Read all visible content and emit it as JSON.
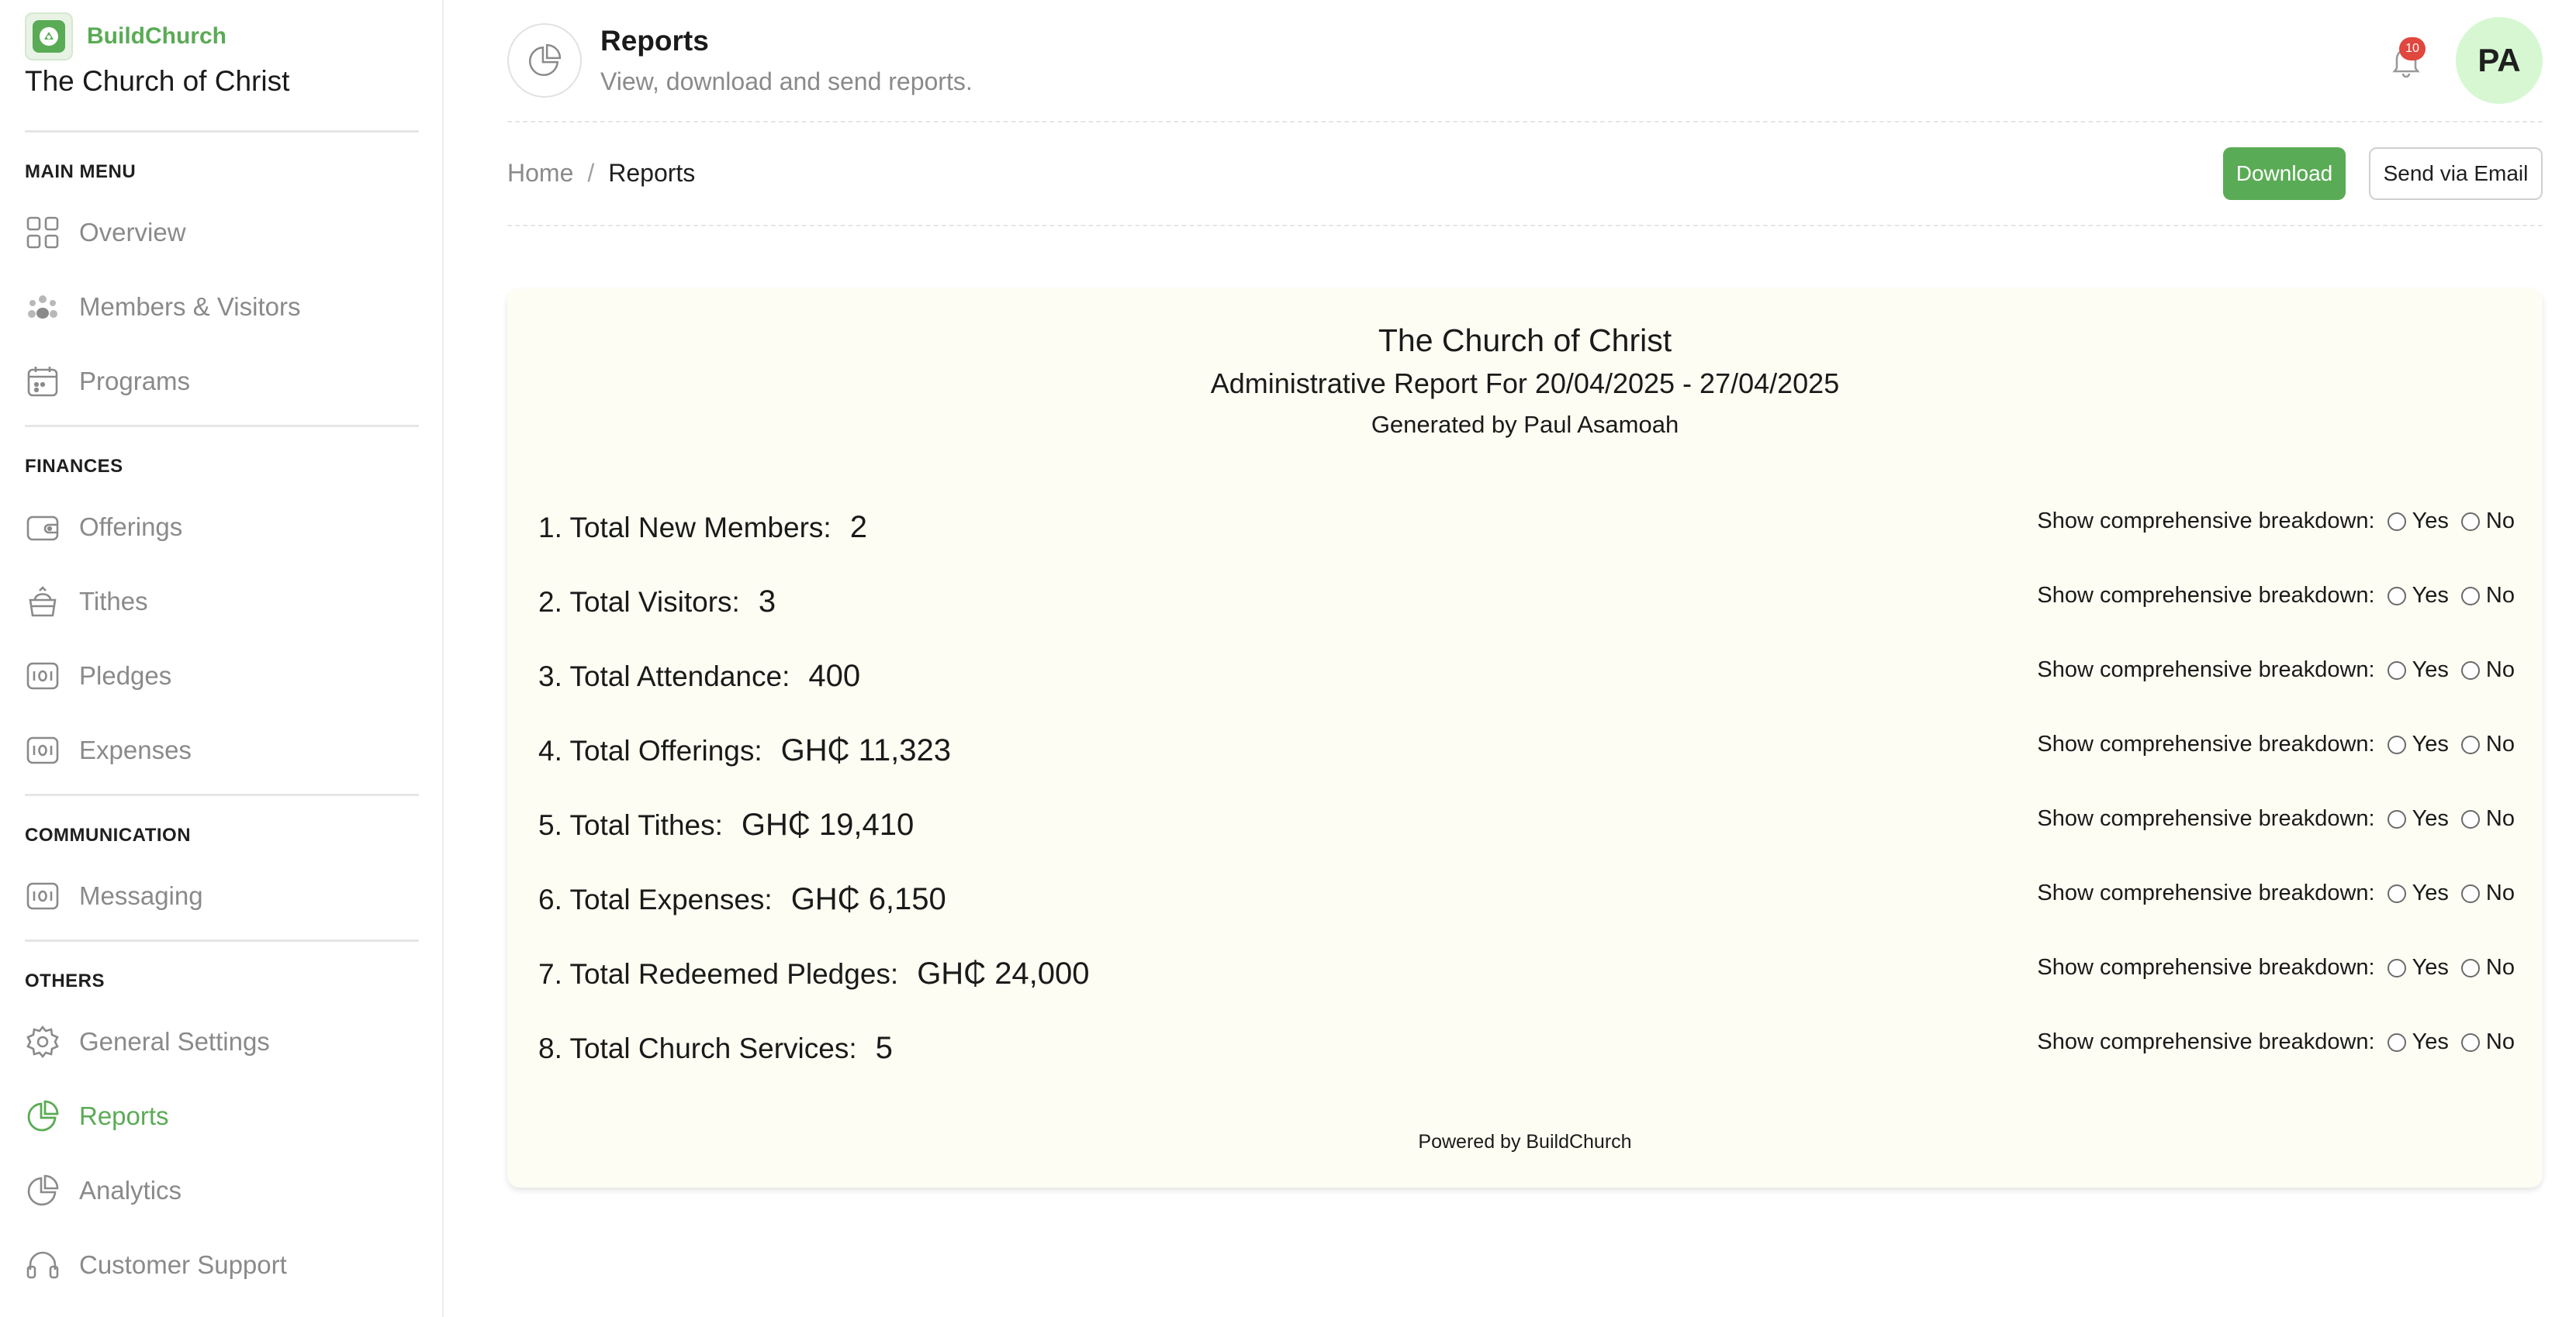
{
  "brand": {
    "name": "BuildChurch",
    "church": "The Church of Christ",
    "accent": "#5aab55"
  },
  "sidebar": {
    "sections": [
      {
        "label": "MAIN MENU"
      },
      {
        "label": "FINANCES"
      },
      {
        "label": "COMMUNICATION"
      },
      {
        "label": "OTHERS"
      }
    ],
    "items": [
      {
        "label": "Overview",
        "icon": "grid-icon"
      },
      {
        "label": "Members & Visitors",
        "icon": "people-icon"
      },
      {
        "label": "Programs",
        "icon": "calendar-icon"
      },
      {
        "label": "Offerings",
        "icon": "wallet-icon"
      },
      {
        "label": "Tithes",
        "icon": "basket-icon"
      },
      {
        "label": "Pledges",
        "icon": "money-icon"
      },
      {
        "label": "Expenses",
        "icon": "money-icon"
      },
      {
        "label": "Messaging",
        "icon": "money-icon"
      },
      {
        "label": "General Settings",
        "icon": "gear-icon"
      },
      {
        "label": "Reports",
        "icon": "pie-chart-icon",
        "active": true
      },
      {
        "label": "Analytics",
        "icon": "pie-chart-icon"
      },
      {
        "label": "Customer Support",
        "icon": "headset-icon"
      }
    ]
  },
  "header": {
    "title": "Reports",
    "subtitle": "View, download and send reports.",
    "notification_count": "10",
    "avatar_initials": "PA"
  },
  "breadcrumb": {
    "home": "Home",
    "separator": "/",
    "current": "Reports"
  },
  "actions": {
    "download": "Download",
    "email": "Send via Email"
  },
  "report": {
    "title": "The Church of Christ",
    "subtitle": "Administrative Report For 20/04/2025 - 27/04/2025",
    "generated_by": "Generated by Paul Asamoah",
    "breakdown_label": "Show comprehensive breakdown:",
    "yes_label": "Yes",
    "no_label": "No",
    "rows": [
      {
        "label": "1. Total New Members:",
        "value": "2"
      },
      {
        "label": "2. Total Visitors:",
        "value": "3"
      },
      {
        "label": "3. Total Attendance:",
        "value": "400"
      },
      {
        "label": "4. Total Offerings:",
        "value": "GH₵ 11,323"
      },
      {
        "label": "5. Total Tithes:",
        "value": "GH₵ 19,410"
      },
      {
        "label": "6. Total Expenses:",
        "value": "GH₵ 6,150"
      },
      {
        "label": "7. Total Redeemed Pledges:",
        "value": "GH₵ 24,000"
      },
      {
        "label": "8. Total Church Services:",
        "value": "5"
      }
    ],
    "footer": "Powered by BuildChurch"
  }
}
